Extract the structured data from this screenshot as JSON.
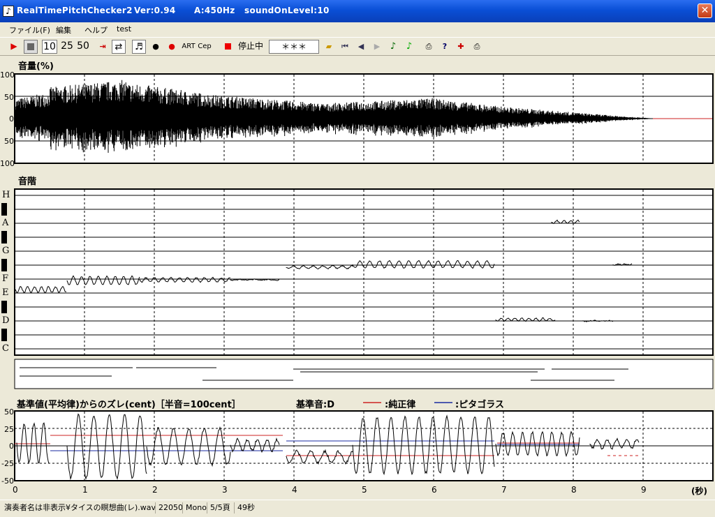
{
  "title": {
    "app": "RealTimePitchChecker2",
    "version": "Ver:0.94",
    "a_freq": "A:450Hz",
    "sound_level": "soundOnLevel:10",
    "close": "✕"
  },
  "menu": [
    "ファイル(F)",
    "編集",
    "ヘルプ",
    "test"
  ],
  "toolbar": {
    "speed_10": "10",
    "speed_25": "25",
    "speed_50": "50",
    "art": "ART",
    "cep": "Cep",
    "state": "停止中",
    "display": "＊＊＊"
  },
  "volume_panel": {
    "title": "音量(%)",
    "y_ticks": [
      "100",
      "50",
      "0",
      "50",
      "100"
    ]
  },
  "scale_panel": {
    "title": "音階",
    "notes": [
      "H",
      "A",
      "G",
      "F",
      "E",
      "D",
      "C"
    ]
  },
  "deviation_panel": {
    "title": "基準値(平均律)からのズレ(cent)［半音=100cent］",
    "ref": "基準音:D",
    "legend_just": ":純正律",
    "legend_pyth": ":ピタゴラス",
    "y_ticks": [
      "50",
      "25",
      "0",
      "-25",
      "-50"
    ]
  },
  "x_axis": {
    "ticks": [
      "0",
      "1",
      "2",
      "3",
      "4",
      "5",
      "6",
      "7",
      "8",
      "9"
    ],
    "unit": "(秒)"
  },
  "statusbar": {
    "file": "演奏者名は非表示¥タイスの瞑想曲(レ).wav",
    "rate": "22050",
    "channel": "Mono",
    "page": "5/5頁",
    "duration": "49秒"
  },
  "colors": {
    "titlebar": "#0a4fd6",
    "just_line": "#cc2222",
    "pyth_line": "#1a2aa0",
    "waveform": "#000000"
  }
}
